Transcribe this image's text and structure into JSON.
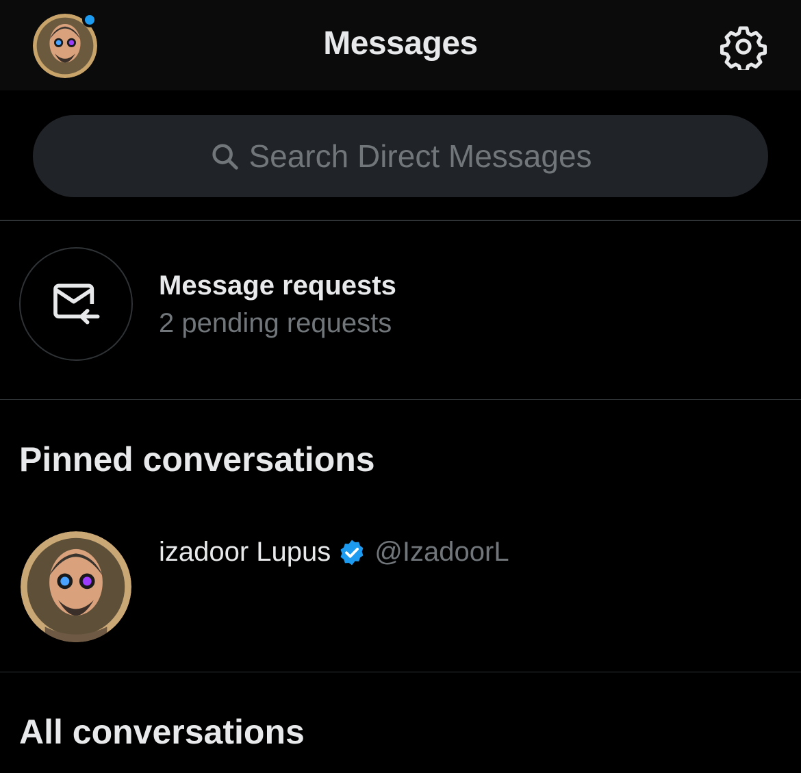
{
  "header": {
    "title": "Messages",
    "has_notification_dot": true
  },
  "search": {
    "placeholder": "Search Direct Messages"
  },
  "requests": {
    "title": "Message requests",
    "subtitle": "2 pending requests"
  },
  "sections": {
    "pinned": "Pinned conversations",
    "all": "All conversations"
  },
  "pinned_conversations": [
    {
      "name": "izadoor Lupus",
      "verified": true,
      "handle": "@IzadoorL"
    }
  ],
  "colors": {
    "background": "#000000",
    "topbar": "#0b0b0c",
    "search_bg": "#202327",
    "primary_text": "#e7e9ea",
    "secondary_text": "#71767b",
    "divider": "#2f3336",
    "accent": "#1d9bf0"
  },
  "icons": {
    "settings": "gear-icon",
    "search": "search-icon",
    "requests": "mail-inbound-icon",
    "verified": "verified-badge-icon"
  }
}
